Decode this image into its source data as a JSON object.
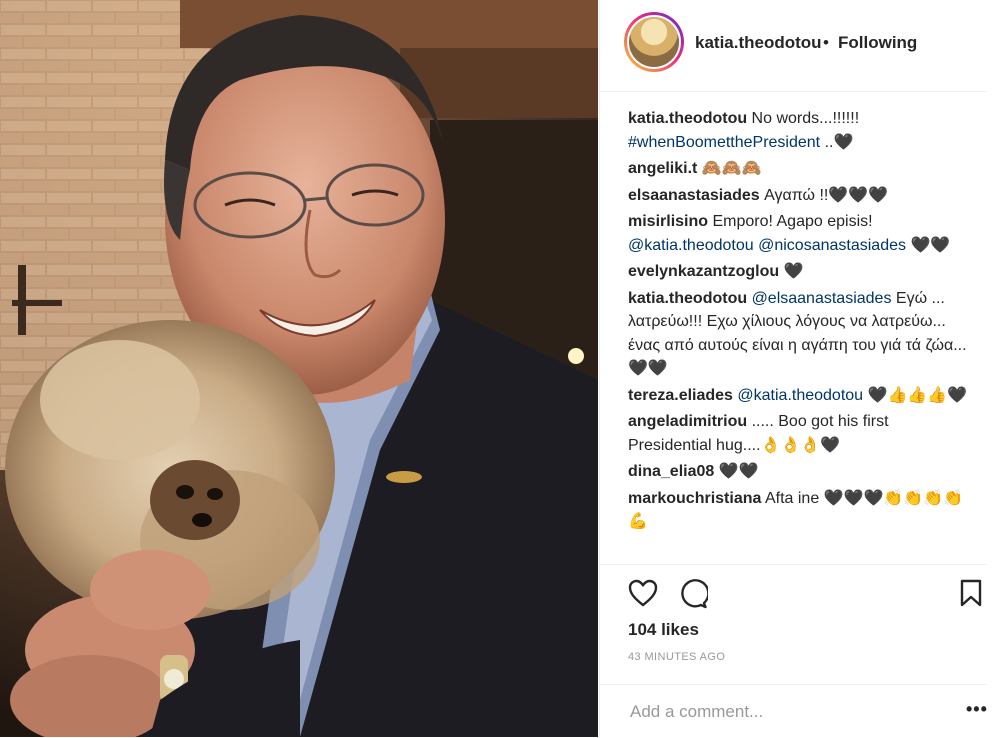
{
  "post": {
    "image_description_alt": "",
    "username": "katia.theodotou",
    "separator": "•",
    "follow_status": "Following",
    "avatar_icon": "profile-avatar"
  },
  "comments": [
    {
      "user": "katia.theodotou",
      "text": " No words...!!!!!! ",
      "link": "#whenBoometthePresident",
      "tail": " ..🖤"
    },
    {
      "user": "angeliki.t",
      "text": " 🙈🙈🙈",
      "link": "",
      "tail": ""
    },
    {
      "user": "elsaanastasiades",
      "text": " Αγαπώ !!🖤🖤🖤",
      "link": "",
      "tail": ""
    },
    {
      "user": "misirlisino",
      "text": " Emporo! Agapo episis! ",
      "link": "@katia.theodotou @nicosanastasiades",
      "tail": " 🖤🖤"
    },
    {
      "user": "evelynkazantzoglou",
      "text": " 🖤",
      "link": "",
      "tail": ""
    },
    {
      "user": "katia.theodotou",
      "text": " ",
      "link": "@elsaanastasiades",
      "tail": " Εγώ ... λατρεύω!!! Εχω χίλιους λόγους να λατρεύω... ένας από αυτούς είναι η αγάπη του γιά τά ζώα...🖤🖤"
    },
    {
      "user": "tereza.eliades",
      "text": " ",
      "link": "@katia.theodotou",
      "tail": " 🖤👍👍👍🖤"
    },
    {
      "user": "angeladimitriou",
      "text": " ..... Boo got his first Presidential hug....👌👌👌🖤",
      "link": "",
      "tail": ""
    },
    {
      "user": "dina_elia08",
      "text": " 🖤🖤",
      "link": "",
      "tail": ""
    },
    {
      "user": "markouchristiana",
      "text": " Afta ine 🖤🖤🖤👏👏👏👏💪",
      "link": "",
      "tail": ""
    }
  ],
  "actions": {
    "like_icon": "heart-icon",
    "comment_icon": "comment-icon",
    "save_icon": "bookmark-icon"
  },
  "likes_label": "104 likes",
  "time_label": "43 MINUTES AGO",
  "add_comment": {
    "placeholder": "Add a comment...",
    "more_label": "•••"
  }
}
